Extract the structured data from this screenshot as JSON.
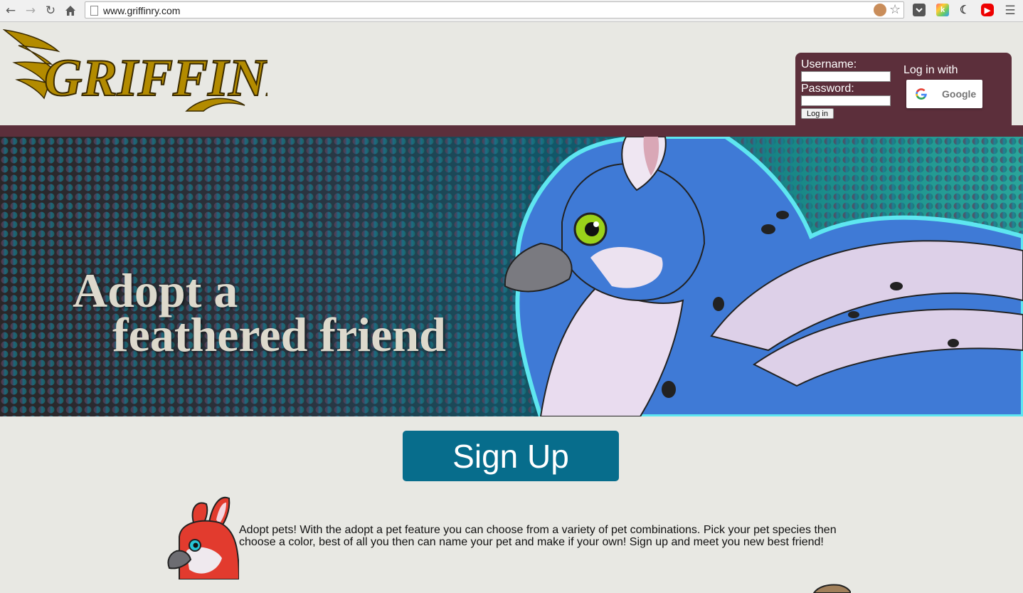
{
  "browser": {
    "url": "www.griffinry.com"
  },
  "site": {
    "logo_text": "GRIFFINRY"
  },
  "login": {
    "username_label": "Username:",
    "password_label": "Password:",
    "login_button": "Log in",
    "login_with_label": "Log in with",
    "google_label": "Google"
  },
  "banner": {
    "line1": "Adopt a",
    "line2": "feathered friend"
  },
  "signup": {
    "label": "Sign Up"
  },
  "features": [
    {
      "text": "Adopt pets! With the adopt a pet feature you can choose from a variety of pet combinations. Pick your pet species then choose a color, best of all you then can name your pet and make if your own! Sign up and meet you new best friend!"
    }
  ],
  "colors": {
    "page_bg": "#e8e8e3",
    "brand_maroon": "#5c2f3b",
    "signup_teal": "#076d8c",
    "logo_gold": "#b38b00"
  }
}
